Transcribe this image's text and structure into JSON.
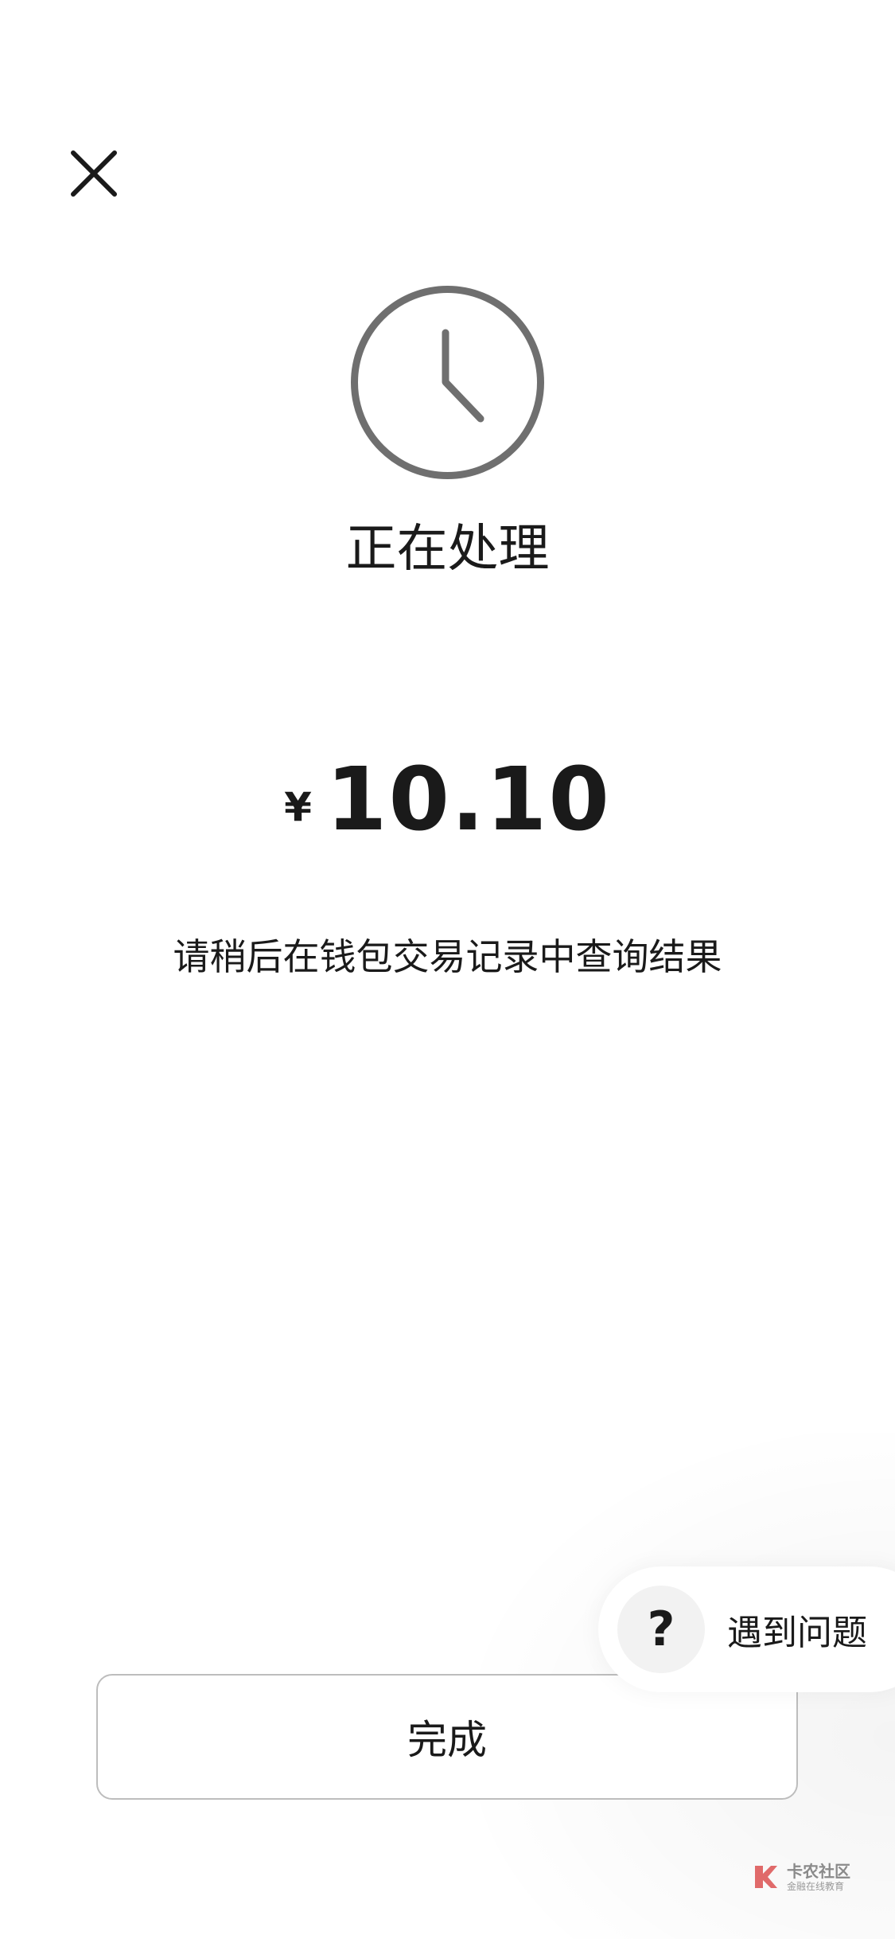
{
  "header": {
    "close_icon": "close-icon"
  },
  "status": {
    "icon": "clock-icon",
    "title": "正在处理"
  },
  "payment": {
    "currency": "¥",
    "amount": "10.10"
  },
  "hint": {
    "text": "请稍后在钱包交易记录中查询结果"
  },
  "actions": {
    "done_label": "完成"
  },
  "help": {
    "icon": "question-icon",
    "icon_glyph": "?",
    "label": "遇到问题"
  },
  "watermark": {
    "title": "卡农社区",
    "subtitle": "金融在线教育"
  },
  "colors": {
    "clock_stroke": "#6f6f6f",
    "text": "#1a1a1a",
    "button_border": "#bdbdbd",
    "help_icon_bg": "#f2f2f2",
    "watermark_logo": "#e06a6a"
  }
}
